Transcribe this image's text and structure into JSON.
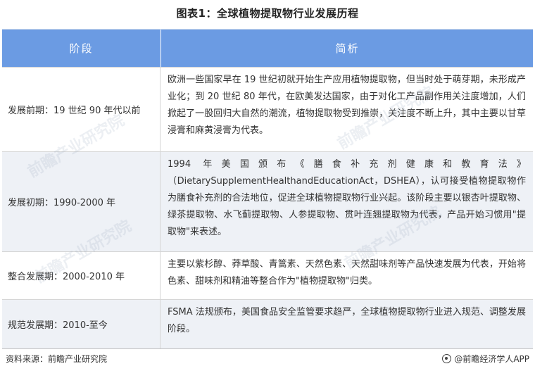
{
  "title": "图表1：全球植物提取物行业发展历程",
  "table": {
    "headers": [
      "阶段",
      "简析"
    ],
    "rows": [
      {
        "stage": "发展前期：19 世纪 90 年代以前",
        "desc": "欧洲一些国家早在 19 世纪初就开始生产应用植物提取物，但当时处于萌芽期，未形成产业化；到 20 世纪 80 年代，在欧美发达国家，由于对化工产品副作用关注度增加，人们掀起了一股回归大自然的潮流，植物提取物受到推崇，关注度不断上升，其中主要以甘草浸膏和麻黄浸膏为代表。"
      },
      {
        "stage": "发展初期：1990-2000 年",
        "desc": "1994 年美国颁布《膳食补充剂健康和教育法》（DietarySupplementHealthandEducationAct，DSHEA），认可接受植物提取物作为膳食补充剂的合法地位，促进全球植物提取物行业兴起。该阶段主要以银杏叶提取物、绿茶提取物、水飞蓟提取物、人参提取物、贯叶连翘提取物为代表，产品开始习惯用\"提取物\"来表述。"
      },
      {
        "stage": "整合发展期：2000-2010 年",
        "desc": "主要以紫杉醇、莽草酸、青篙素、天然色素、天然甜味剂等产品快速发展为代表，开始将色素、甜味剂和精油等整合作为\"植物提取物\"归类。"
      },
      {
        "stage": "规范发展期：2010-至今",
        "desc": "FSMA 法规颁布，美国食品安全监管要求趋严，全球植物提取物行业进入规范、调整发展阶段。"
      }
    ]
  },
  "footer": {
    "source": "资料来源：前瞻产业研究院",
    "brand": "@前瞻经济学人APP"
  },
  "watermark": "前瞻产业研究院",
  "colors": {
    "header_bg": "#6b9be3",
    "row_alt_bg": "#eef1f6"
  }
}
